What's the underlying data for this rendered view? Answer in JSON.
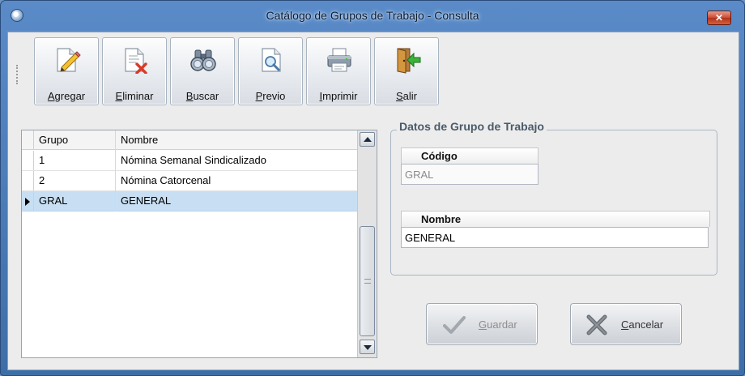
{
  "window": {
    "title": "Catálogo de Grupos de Trabajo - Consulta",
    "close_glyph": "✕"
  },
  "toolbar": {
    "buttons": [
      {
        "label": "Agregar",
        "icon": "pencil-document-icon"
      },
      {
        "label": "Eliminar",
        "icon": "delete-document-icon"
      },
      {
        "label": "Buscar",
        "icon": "binoculars-icon"
      },
      {
        "label": "Previo",
        "icon": "print-preview-icon"
      },
      {
        "label": "Imprimir",
        "icon": "printer-icon"
      },
      {
        "label": "Salir",
        "icon": "exit-door-icon"
      }
    ]
  },
  "grid": {
    "columns": [
      "Grupo",
      "Nombre"
    ],
    "rows": [
      {
        "grupo": "1",
        "nombre": "Nómina Semanal Sindicalizado"
      },
      {
        "grupo": "2",
        "nombre": "Nómina Catorcenal"
      },
      {
        "grupo": "GRAL",
        "nombre": "GENERAL"
      }
    ],
    "selected_index": 2
  },
  "details": {
    "title": "Datos de Grupo de Trabajo",
    "codigo_label": "Código",
    "codigo_value": "GRAL",
    "nombre_label": "Nombre",
    "nombre_value": "GENERAL"
  },
  "actions": {
    "guardar_label": "Guardar",
    "cancelar_label": "Cancelar"
  },
  "colors": {
    "selected_row": "#c8dff3",
    "titlebar": "#5a8bc8",
    "close_button": "#c94a32"
  }
}
